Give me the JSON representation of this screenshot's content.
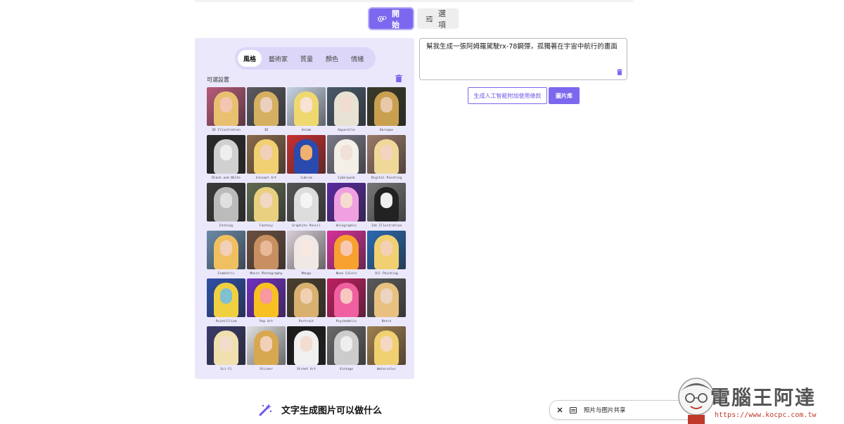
{
  "mode_tabs": [
    {
      "label": "開始",
      "icon": "gears-icon",
      "active": true
    },
    {
      "label": "選項",
      "icon": "sliders-icon",
      "active": false
    }
  ],
  "panel": {
    "sub_tabs": [
      {
        "label": "風格",
        "active": true
      },
      {
        "label": "藝術家",
        "active": false
      },
      {
        "label": "質量",
        "active": false
      },
      {
        "label": "顏色",
        "active": false
      },
      {
        "label": "情緒",
        "active": false
      }
    ],
    "optional_label": "可選設置",
    "styles": [
      {
        "label": "3D Illustration",
        "bg": "#b85a7a",
        "hair": "#e8c070",
        "face": "#f2c6b0"
      },
      {
        "label": "3D",
        "bg": "#5a5a60",
        "hair": "#d4b060",
        "face": "#ead0bc"
      },
      {
        "label": "Anime",
        "bg": "#c8d4e4",
        "hair": "#f0d870",
        "face": "#f8e2d4"
      },
      {
        "label": "Aquarelle",
        "bg": "#4a5a6a",
        "hair": "#e8e2d4",
        "face": "#f2dcd0"
      },
      {
        "label": "Baroque",
        "bg": "#3a3a2a",
        "hair": "#c8a050",
        "face": "#e8c8a8"
      },
      {
        "label": "Black and White",
        "bg": "#2a2a2a",
        "hair": "#d0d0d0",
        "face": "#eeeeee"
      },
      {
        "label": "Concept Art",
        "bg": "#8a6a4a",
        "hair": "#f0d070",
        "face": "#f0d0b8"
      },
      {
        "label": "Cubism",
        "bg": "#c83030",
        "hair": "#2a4ab0",
        "face": "#f0b070"
      },
      {
        "label": "Cyberpunk",
        "bg": "#7a7a88",
        "hair": "#f4f0e8",
        "face": "#f0e0d8"
      },
      {
        "label": "Digital Painting",
        "bg": "#9a7a6a",
        "hair": "#f0d898",
        "face": "#f2d4c0"
      },
      {
        "label": "Etching",
        "bg": "#3a3a3a",
        "hair": "#bbbbbb",
        "face": "#e0e0e0"
      },
      {
        "label": "Fantasy",
        "bg": "#606a50",
        "hair": "#e8d080",
        "face": "#f2d8c4"
      },
      {
        "label": "Graphite Pencil",
        "bg": "#555555",
        "hair": "#dddddd",
        "face": "#f4f4f4"
      },
      {
        "label": "Holographic",
        "bg": "#5a2aa0",
        "hair": "#f0a0e0",
        "face": "#f6dcd0"
      },
      {
        "label": "Ink Illustration",
        "bg": "#777777",
        "hair": "#222222",
        "face": "#f0f0f0"
      },
      {
        "label": "Isometric",
        "bg": "#6a8aa8",
        "hair": "#f0c060",
        "face": "#f2d0b8"
      },
      {
        "label": "Macro Photography",
        "bg": "#6a5040",
        "hair": "#c89060",
        "face": "#e8b898"
      },
      {
        "label": "Manga",
        "bg": "#d8d0d8",
        "hair": "#f0e8e4",
        "face": "#f8e8e0"
      },
      {
        "label": "Neon Colors",
        "bg": "#d8309a",
        "hair": "#f8a030",
        "face": "#f8c8b0"
      },
      {
        "label": "Oil Painting",
        "bg": "#2a6ab0",
        "hair": "#f0d070",
        "face": "#f4d0b4"
      },
      {
        "label": "Pointillism",
        "bg": "#3050a8",
        "hair": "#f0d040",
        "face": "#80c0d0"
      },
      {
        "label": "Pop Art",
        "bg": "#7030c0",
        "hair": "#f8c020",
        "face": "#f898a0"
      },
      {
        "label": "Portrait",
        "bg": "#4a4030",
        "hair": "#d8b070",
        "face": "#f0d0b0"
      },
      {
        "label": "Psychedelic",
        "bg": "#c02060",
        "hair": "#f060a0",
        "face": "#f8c8c0"
      },
      {
        "label": "Retro",
        "bg": "#5a5a5a",
        "hair": "#e8c080",
        "face": "#ecd4c0"
      },
      {
        "label": "Sci-Fi",
        "bg": "#3a3a6a",
        "hair": "#f0e0b0",
        "face": "#f4dccc"
      },
      {
        "label": "Sticker",
        "bg": "#e0e0e0",
        "hair": "#d8a850",
        "face": "#f2d0b8"
      },
      {
        "label": "Street Art",
        "bg": "#1a1a1a",
        "hair": "#f0f0f0",
        "face": "#f4dcd0"
      },
      {
        "label": "Vintage",
        "bg": "#6a6a6a",
        "hair": "#cccccc",
        "face": "#eeeeee"
      },
      {
        "label": "Watercolor",
        "bg": "#a08050",
        "hair": "#f0d070",
        "face": "#f4d8c4"
      }
    ]
  },
  "prompt": {
    "text": "幫我生成一張阿姆羅駕駛rx-78鋼彈，孤獨著在宇宙中航行的畫面"
  },
  "buttons": {
    "terms_label": "生成人工智能附加使用條款",
    "gallery_label": "圖片库"
  },
  "section": {
    "title": "文字生成图片可以做什么"
  },
  "toast": {
    "text": "照片与图片共享"
  },
  "watermark": {
    "title": "電腦王阿達",
    "url": "https://www.kocpc.com.tw"
  },
  "colors": {
    "accent": "#7b68ee",
    "panel_bg": "#ebe8fc"
  }
}
